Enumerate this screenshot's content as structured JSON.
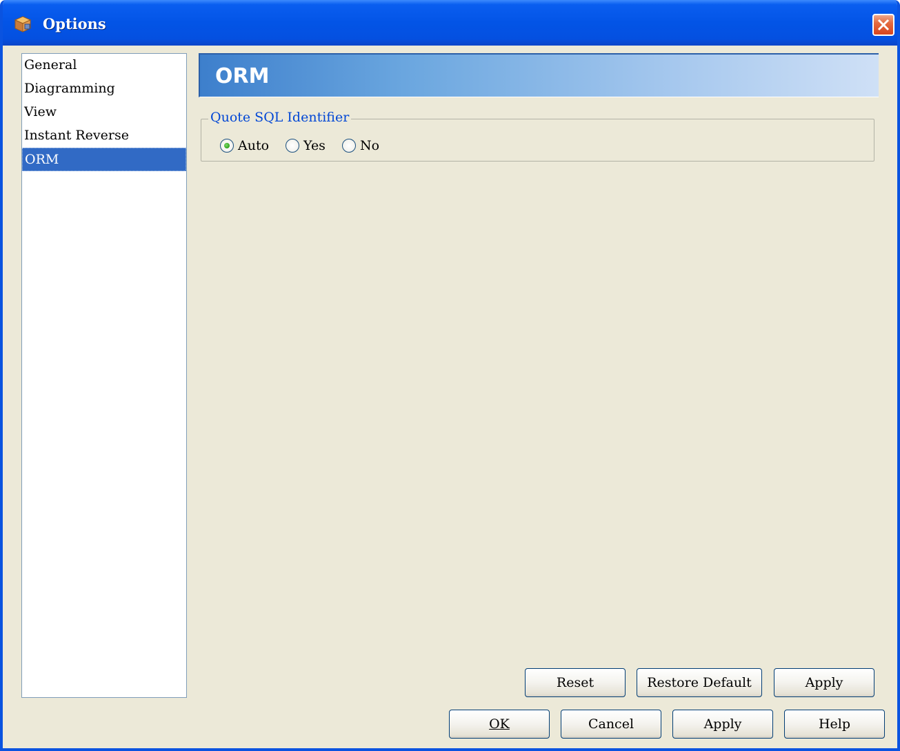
{
  "window": {
    "title": "Options"
  },
  "nav": {
    "items": [
      {
        "label": "General"
      },
      {
        "label": "Diagramming"
      },
      {
        "label": "View"
      },
      {
        "label": "Instant Reverse"
      },
      {
        "label": "ORM"
      }
    ],
    "selected": "ORM"
  },
  "panel": {
    "header": "ORM",
    "group": {
      "legend": "Quote SQL Identifier",
      "options": [
        {
          "label": "Auto",
          "checked": true
        },
        {
          "label": "Yes",
          "checked": false
        },
        {
          "label": "No",
          "checked": false
        }
      ]
    }
  },
  "buttons": {
    "reset": "Reset",
    "restore_default": "Restore Default",
    "apply_panel": "Apply",
    "ok": "OK",
    "cancel": "Cancel",
    "apply": "Apply",
    "help": "Help"
  },
  "colors": {
    "titlebar": "#0354e6",
    "selection": "#316ac5",
    "legend_text": "#0046d5",
    "dialog_bg": "#ece9d8"
  }
}
